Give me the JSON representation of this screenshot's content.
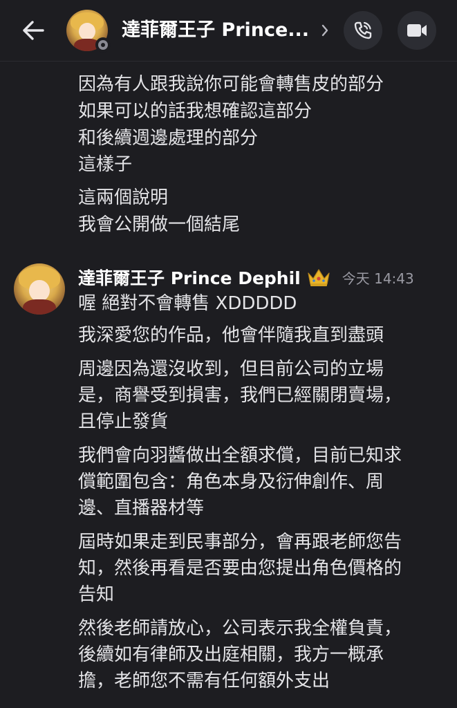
{
  "header": {
    "title": "達菲爾王子 Prince...",
    "chevron_icon": "chevron-right-icon",
    "back_icon": "arrow-left-icon",
    "call_icon": "phone-icon",
    "video_icon": "video-camera-icon"
  },
  "previous_messages": [
    "因為有人跟我說你可能會轉售皮的部分",
    "如果可以的話我想確認這部分",
    "和後續週邊處理的部分",
    "這樣子",
    "這兩個說明",
    "我會公開做一個結尾"
  ],
  "reply": {
    "author": "達菲爾王子 Prince Dephil",
    "badge_icon": "crown-icon",
    "timestamp": "今天 14:43",
    "lines": [
      "喔 絕對不會轉售 XDDDDD",
      "我深愛您的作品，他會伴隨我直到盡頭",
      "周邊因為還沒收到，但目前公司的立場",
      "是，商譽受到損害，我們已經關閉賣場，",
      "且停止發貨",
      "我們會向羽醬做出全額求償，目前已知求",
      "償範圍包含：角色本身及衍伸創作、周",
      "邊、直播器材等",
      "屆時如果走到民事部分，會再跟老師您告",
      "知，然後再看是否要由您提出角色價格的",
      "告知",
      "然後老師請放心，公司表示我全權負責，",
      "後續如有律師及出庭相關，我方一概承",
      "擔，老師您不需有任何額外支出"
    ]
  },
  "colors": {
    "background": "#1d1d21",
    "text": "#e4e4e7",
    "muted": "#9a9aa3",
    "button_bg": "#2c2d33"
  }
}
